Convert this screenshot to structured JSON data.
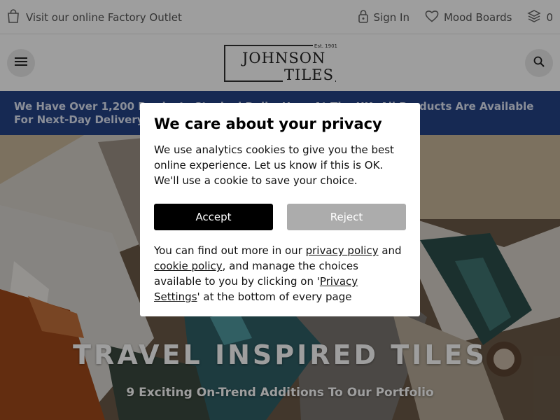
{
  "topbar": {
    "outlet_link": "Visit our online Factory Outlet",
    "sign_in": "Sign In",
    "mood_boards": "Mood Boards",
    "basket_count": "0"
  },
  "header": {
    "logo_est": "Est. 1901",
    "logo_line1": "JOHNSON",
    "logo_line2": "TILES"
  },
  "banner": {
    "text": "We Have Over 1,200 Products Stocked Daily. Here At The UK. All Products Are Available For Next-Day Delivery."
  },
  "hero": {
    "title": "TRAVEL INSPIRED TILES",
    "subtitle": "9 Exciting On-Trend Additions To Our Portfolio"
  },
  "privacy": {
    "heading": "We care about your privacy",
    "body": "We use analytics cookies to give you the best online experience. Let us know if this is OK. We'll use a cookie to save your choice.",
    "accept_label": "Accept",
    "reject_label": "Reject",
    "more_prefix": "You can find out more in our ",
    "privacy_policy_link": "privacy policy",
    "more_and": " and ",
    "cookie_policy_link": "cookie policy",
    "more_middle": ", and manage the choices available to you by clicking on '",
    "privacy_settings_link": "Privacy Settings",
    "more_suffix": "' at the bottom of every page"
  },
  "colors": {
    "banner_bg": "#244386",
    "accept_bg": "#000000",
    "reject_bg": "#acacac"
  },
  "icons": [
    "bag-icon",
    "lock-icon",
    "heart-icon",
    "layers-icon",
    "menu-icon",
    "search-icon"
  ]
}
